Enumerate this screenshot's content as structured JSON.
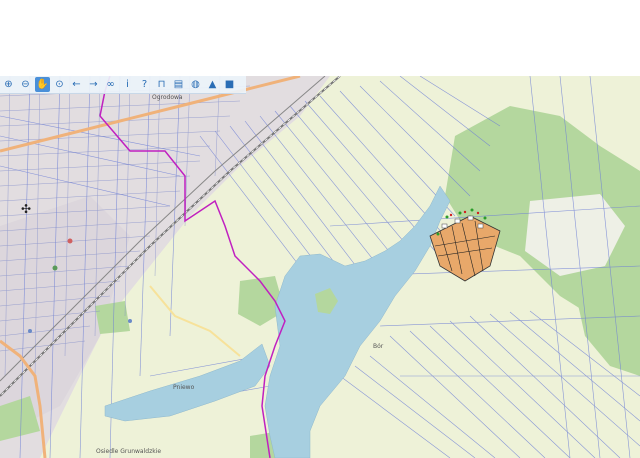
{
  "toolbar": {
    "tools": [
      {
        "name": "zoom-in-icon",
        "glyph": "⊕"
      },
      {
        "name": "zoom-out-icon",
        "glyph": "⊖"
      },
      {
        "name": "pan-hand-icon",
        "glyph": "✋",
        "active": true
      },
      {
        "name": "zoom-box-icon",
        "glyph": "⊙"
      },
      {
        "name": "back-arrow-icon",
        "glyph": "←"
      },
      {
        "name": "forward-arrow-icon",
        "glyph": "→"
      },
      {
        "name": "link-icon",
        "glyph": "∞"
      },
      {
        "name": "info-icon",
        "glyph": "i"
      },
      {
        "name": "query-icon",
        "glyph": "?"
      },
      {
        "name": "measure-icon",
        "glyph": "⊓"
      },
      {
        "name": "print-icon",
        "glyph": "▤"
      },
      {
        "name": "globe-icon",
        "glyph": "◍"
      },
      {
        "name": "alert-icon",
        "glyph": "▲"
      },
      {
        "name": "camera-icon",
        "glyph": "■"
      }
    ]
  },
  "map": {
    "labels": {
      "top_street": "Ogrodowa",
      "lake_west": "Pniewo",
      "village_east": "Bór",
      "bottom_left": "Osiedle Grunwaldzkie"
    },
    "colors": {
      "water": "#a7cfe0",
      "forest": "#b4d79e",
      "farmland": "#eef2d8",
      "urban": "#e2dde0",
      "parcel_line": "#6e7fd6",
      "boundary": "#c020c0",
      "road": "#f0b27a",
      "parcel_fill": "#e8a86a"
    }
  }
}
